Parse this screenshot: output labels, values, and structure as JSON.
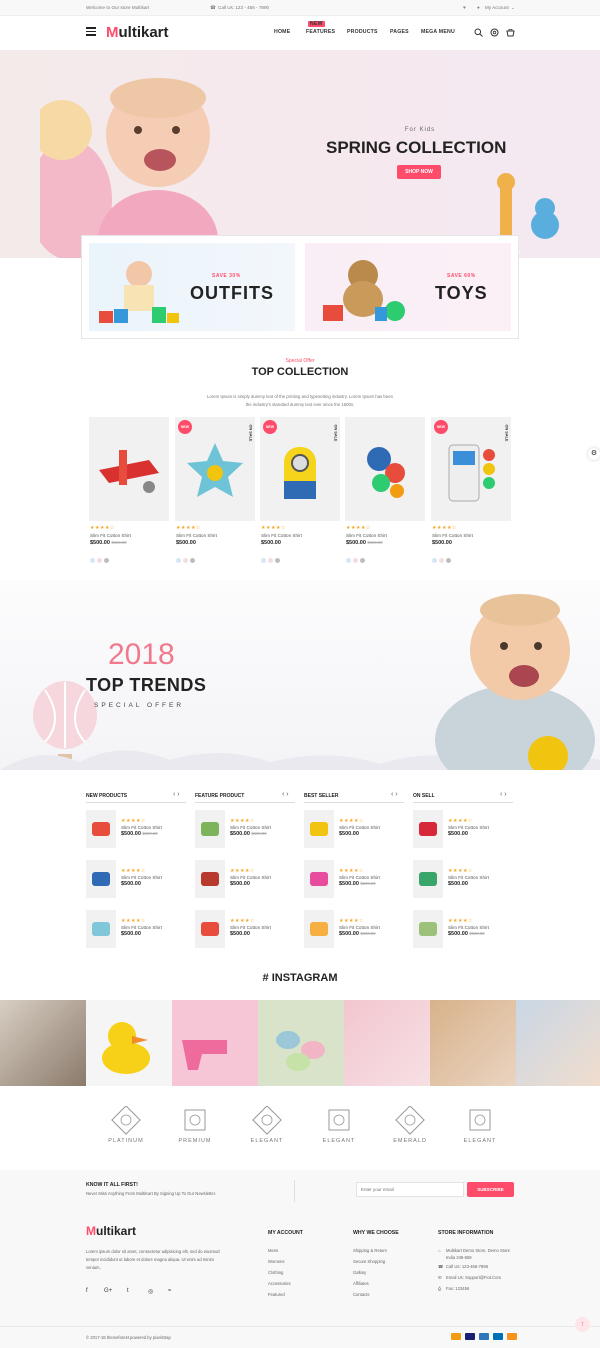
{
  "topbar": {
    "welcome": "Welcome to Our store Multikart",
    "call": "Call Us: 123 - 456 - 7890",
    "account": "My Account"
  },
  "header": {
    "logo_m": "M",
    "logo_rest": "ultikart",
    "nav": [
      "HOME",
      "FEATURES",
      "PRODUCTS",
      "PAGES",
      "MEGA MENU"
    ],
    "new_badge": "NEW"
  },
  "hero": {
    "kicker": "For Kids",
    "title": "SPRING COLLECTION",
    "button": "SHOP NOW"
  },
  "banners": [
    {
      "save": "SAVE 30%",
      "title": "OUTFITS"
    },
    {
      "save": "SAVE 60%",
      "title": "TOYS"
    }
  ],
  "collection": {
    "kicker": "Special Offer",
    "title": "TOP COLLECTION",
    "desc1": "Lorem Ipsum is simply dummy text of the printing and typesetting industry. Lorem Ipsum has been",
    "desc2": "the industry's standard dummy text ever since the 1500s."
  },
  "products": [
    {
      "name": "Slim Fit Cotton Shirt",
      "price": "$500.00",
      "old": "$600.00",
      "badge": "",
      "side": ""
    },
    {
      "name": "Slim Fit Cotton Shirt",
      "price": "$500.00",
      "old": "",
      "badge": "NEW",
      "side": "ON SALE"
    },
    {
      "name": "Slim Fit Cotton Shirt",
      "price": "$500.00",
      "old": "",
      "badge": "NEW",
      "side": "ON SALE"
    },
    {
      "name": "Slim Fit Cotton Shirt",
      "price": "$500.00",
      "old": "$600.00",
      "badge": "",
      "side": ""
    },
    {
      "name": "Slim Fit Cotton Shirt",
      "price": "$500.00",
      "old": "",
      "badge": "NEW",
      "side": "ON SALE"
    }
  ],
  "stars": "★★★★☆",
  "trends": {
    "year": "2018",
    "title": "TOP TRENDS",
    "sub": "SPECIAL OFFER"
  },
  "columns": [
    {
      "title": "NEW PRODUCTS",
      "items": [
        {
          "price": "$500.00",
          "old": "$600.00"
        },
        {
          "price": "$500.00",
          "old": ""
        },
        {
          "price": "$500.00",
          "old": ""
        }
      ]
    },
    {
      "title": "FEATURE PRODUCT",
      "items": [
        {
          "price": "$500.00",
          "old": "$600.00"
        },
        {
          "price": "$500.00",
          "old": ""
        },
        {
          "price": "$500.00",
          "old": ""
        }
      ]
    },
    {
      "title": "BEST SELLER",
      "items": [
        {
          "price": "$500.00",
          "old": ""
        },
        {
          "price": "$500.00",
          "old": "$600.00"
        },
        {
          "price": "$500.00",
          "old": "$600.00"
        }
      ]
    },
    {
      "title": "ON SELL",
      "items": [
        {
          "price": "$500.00",
          "old": ""
        },
        {
          "price": "$500.00",
          "old": ""
        },
        {
          "price": "$500.00",
          "old": "$600.00"
        }
      ]
    }
  ],
  "small_name": "Slim Fit Cotton Shirt",
  "instagram": {
    "title": "# INSTAGRAM"
  },
  "brands": [
    "PLATINUM",
    "PREMIUM",
    "ELEGANT",
    "ELEGANT",
    "EMERALD",
    "ELEGANT"
  ],
  "newsletter": {
    "title": "KNOW IT ALL FIRST!",
    "text": "Never Miss Anything From MultiKart By Signing Up To Our Newsletter.",
    "placeholder": "Enter your email",
    "button": "SUBSCRIBE"
  },
  "footer": {
    "about": "Lorem ipsum dolor sit amet, consectetur adipisicing elit, sed do eiusmod tempor incididunt ut labore et dolore magna aliqua. Ut enim ad minim veniam,",
    "account_title": "MY ACCOUNT",
    "account_links": [
      "Mens",
      "Womens",
      "Clothing",
      "Accessories",
      "Featured"
    ],
    "why_title": "WHY WE CHOOSE",
    "why_links": [
      "Shipping & Return",
      "Secure Shopping",
      "Gallary",
      "Affiliates",
      "Contacts"
    ],
    "store_title": "STORE INFORMATION",
    "store": [
      "Multikart Demo Store, Demo Store India 345-659",
      "Call Us: 123-456-7898",
      "Email Us: Support@Fiot.Com",
      "Fax: 123456"
    ]
  },
  "copyright": "© 2017-18 themeforest powered by pixelstrap",
  "colors": {
    "accent": "#ff4c6a"
  }
}
